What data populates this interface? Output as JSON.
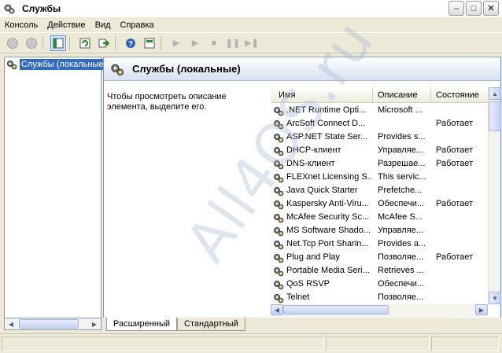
{
  "window": {
    "title": "Службы",
    "minimize_label": "–",
    "maximize_label": "□",
    "close_label": "✕"
  },
  "menu": [
    {
      "label": "Консоль"
    },
    {
      "label": "Действие"
    },
    {
      "label": "Вид"
    },
    {
      "label": "Справка"
    }
  ],
  "toolbar": {
    "icons": [
      "back-icon",
      "forward-icon",
      "show-hide-tree-icon",
      "refresh-icon",
      "export-list-icon",
      "help-icon",
      "properties-icon",
      "start-service-icon",
      "start-service-alt-icon",
      "stop-service-icon",
      "pause-service-icon",
      "restart-service-icon"
    ]
  },
  "tree": {
    "selected_label": "Службы (локальные"
  },
  "panel": {
    "title": "Службы (локальные)",
    "description": "Чтобы просмотреть описание элемента, выделите его."
  },
  "list": {
    "columns": [
      "Имя",
      "Описание",
      "Состояние"
    ],
    "rows": [
      {
        "name": ".NET Runtime Opti...",
        "desc": "Microsoft ...",
        "state": ""
      },
      {
        "name": "ArcSoft Connect D...",
        "desc": "",
        "state": "Работает"
      },
      {
        "name": "ASP.NET State Ser...",
        "desc": "Provides s...",
        "state": ""
      },
      {
        "name": "DHCP-клиент",
        "desc": "Управляе...",
        "state": "Работает"
      },
      {
        "name": "DNS-клиент",
        "desc": "Разрешае...",
        "state": "Работает"
      },
      {
        "name": "FLEXnet Licensing S...",
        "desc": "This servic...",
        "state": ""
      },
      {
        "name": "Java Quick Starter",
        "desc": "Prefetche...",
        "state": ""
      },
      {
        "name": "Kaspersky Anti-Viru...",
        "desc": "Обеспечи...",
        "state": "Работает"
      },
      {
        "name": "McAfee Security Sc...",
        "desc": "McAfee S...",
        "state": ""
      },
      {
        "name": "MS Software Shado...",
        "desc": "Управляе...",
        "state": ""
      },
      {
        "name": "Net.Tcp Port Sharin...",
        "desc": "Provides a...",
        "state": ""
      },
      {
        "name": "Plug and Play",
        "desc": "Позволяе...",
        "state": "Работает"
      },
      {
        "name": "Portable Media Seri...",
        "desc": "Retrieves ...",
        "state": ""
      },
      {
        "name": "QoS RSVP",
        "desc": "Обеспечи...",
        "state": ""
      },
      {
        "name": "Telnet",
        "desc": "Позволяе...",
        "state": ""
      }
    ]
  },
  "tabs": [
    {
      "label": "Расширенный"
    },
    {
      "label": "Стандартный"
    }
  ],
  "watermark": "All4OS.ru"
}
